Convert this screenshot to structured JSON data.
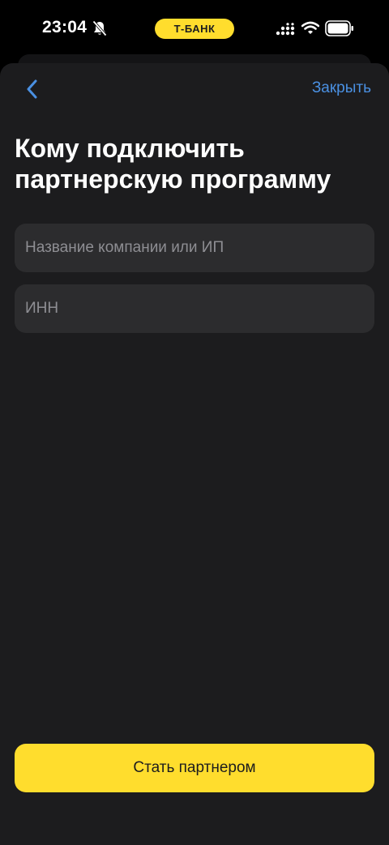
{
  "status_bar": {
    "time": "23:04",
    "brand": "Т-БАНК",
    "icons": [
      "bell-off-icon",
      "signal-icon",
      "wifi-icon",
      "battery-icon"
    ]
  },
  "nav": {
    "back_icon": "chevron-left-icon",
    "close_label": "Закрыть"
  },
  "main": {
    "title": "Кому подключить партнерскую программу",
    "fields": {
      "company": {
        "placeholder": "Название компании или ИП",
        "value": ""
      },
      "inn": {
        "placeholder": "ИНН",
        "value": ""
      }
    },
    "submit_label": "Стать партнером"
  },
  "colors": {
    "accent": "#ffdd2d",
    "link": "#4a90e2",
    "sheet_background": "#1c1c1e",
    "field_background": "#2c2c2e",
    "placeholder": "#8e8e93"
  }
}
